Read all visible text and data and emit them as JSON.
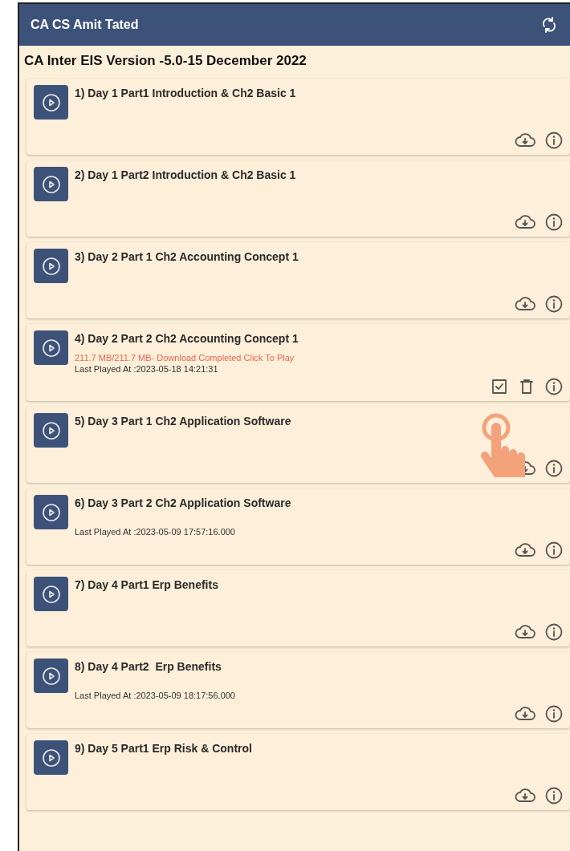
{
  "app_bar": {
    "title": "CA CS Amit Tated"
  },
  "heading": "CA Inter EIS Version -5.0-15 December 2022",
  "lectures": [
    {
      "title": "1) Day 1 Part1 Introduction & Ch2 Basic 1",
      "kind": "cloud"
    },
    {
      "title": "2) Day 1 Part2 Introduction & Ch2 Basic 1",
      "kind": "cloud"
    },
    {
      "title": "3) Day 2 Part 1 Ch2 Accounting Concept 1",
      "kind": "cloud"
    },
    {
      "title": "4) Day 2 Part 2 Ch2 Accounting Concept 1",
      "kind": "downloaded",
      "status": "211.7 MB/211.7 MB- Download Completed Click To Play",
      "last_played": "Last Played At :2023-05-18 14:21:31"
    },
    {
      "title": "5) Day 3 Part 1 Ch2 Application Software",
      "kind": "cloud"
    },
    {
      "title": "6) Day 3 Part 2 Ch2 Application Software",
      "kind": "cloud",
      "last_played": "Last Played At :2023-05-09 17:57:16.000"
    },
    {
      "title": "7) Day 4 Part1 Erp Benefits",
      "kind": "cloud"
    },
    {
      "title": "8) Day 4 Part2  Erp Benefits",
      "kind": "cloud",
      "last_played": "Last Played At :2023-05-09 18:17:56.000"
    },
    {
      "title": "9) Day 5 Part1 Erp Risk & Control",
      "kind": "cloud"
    }
  ]
}
